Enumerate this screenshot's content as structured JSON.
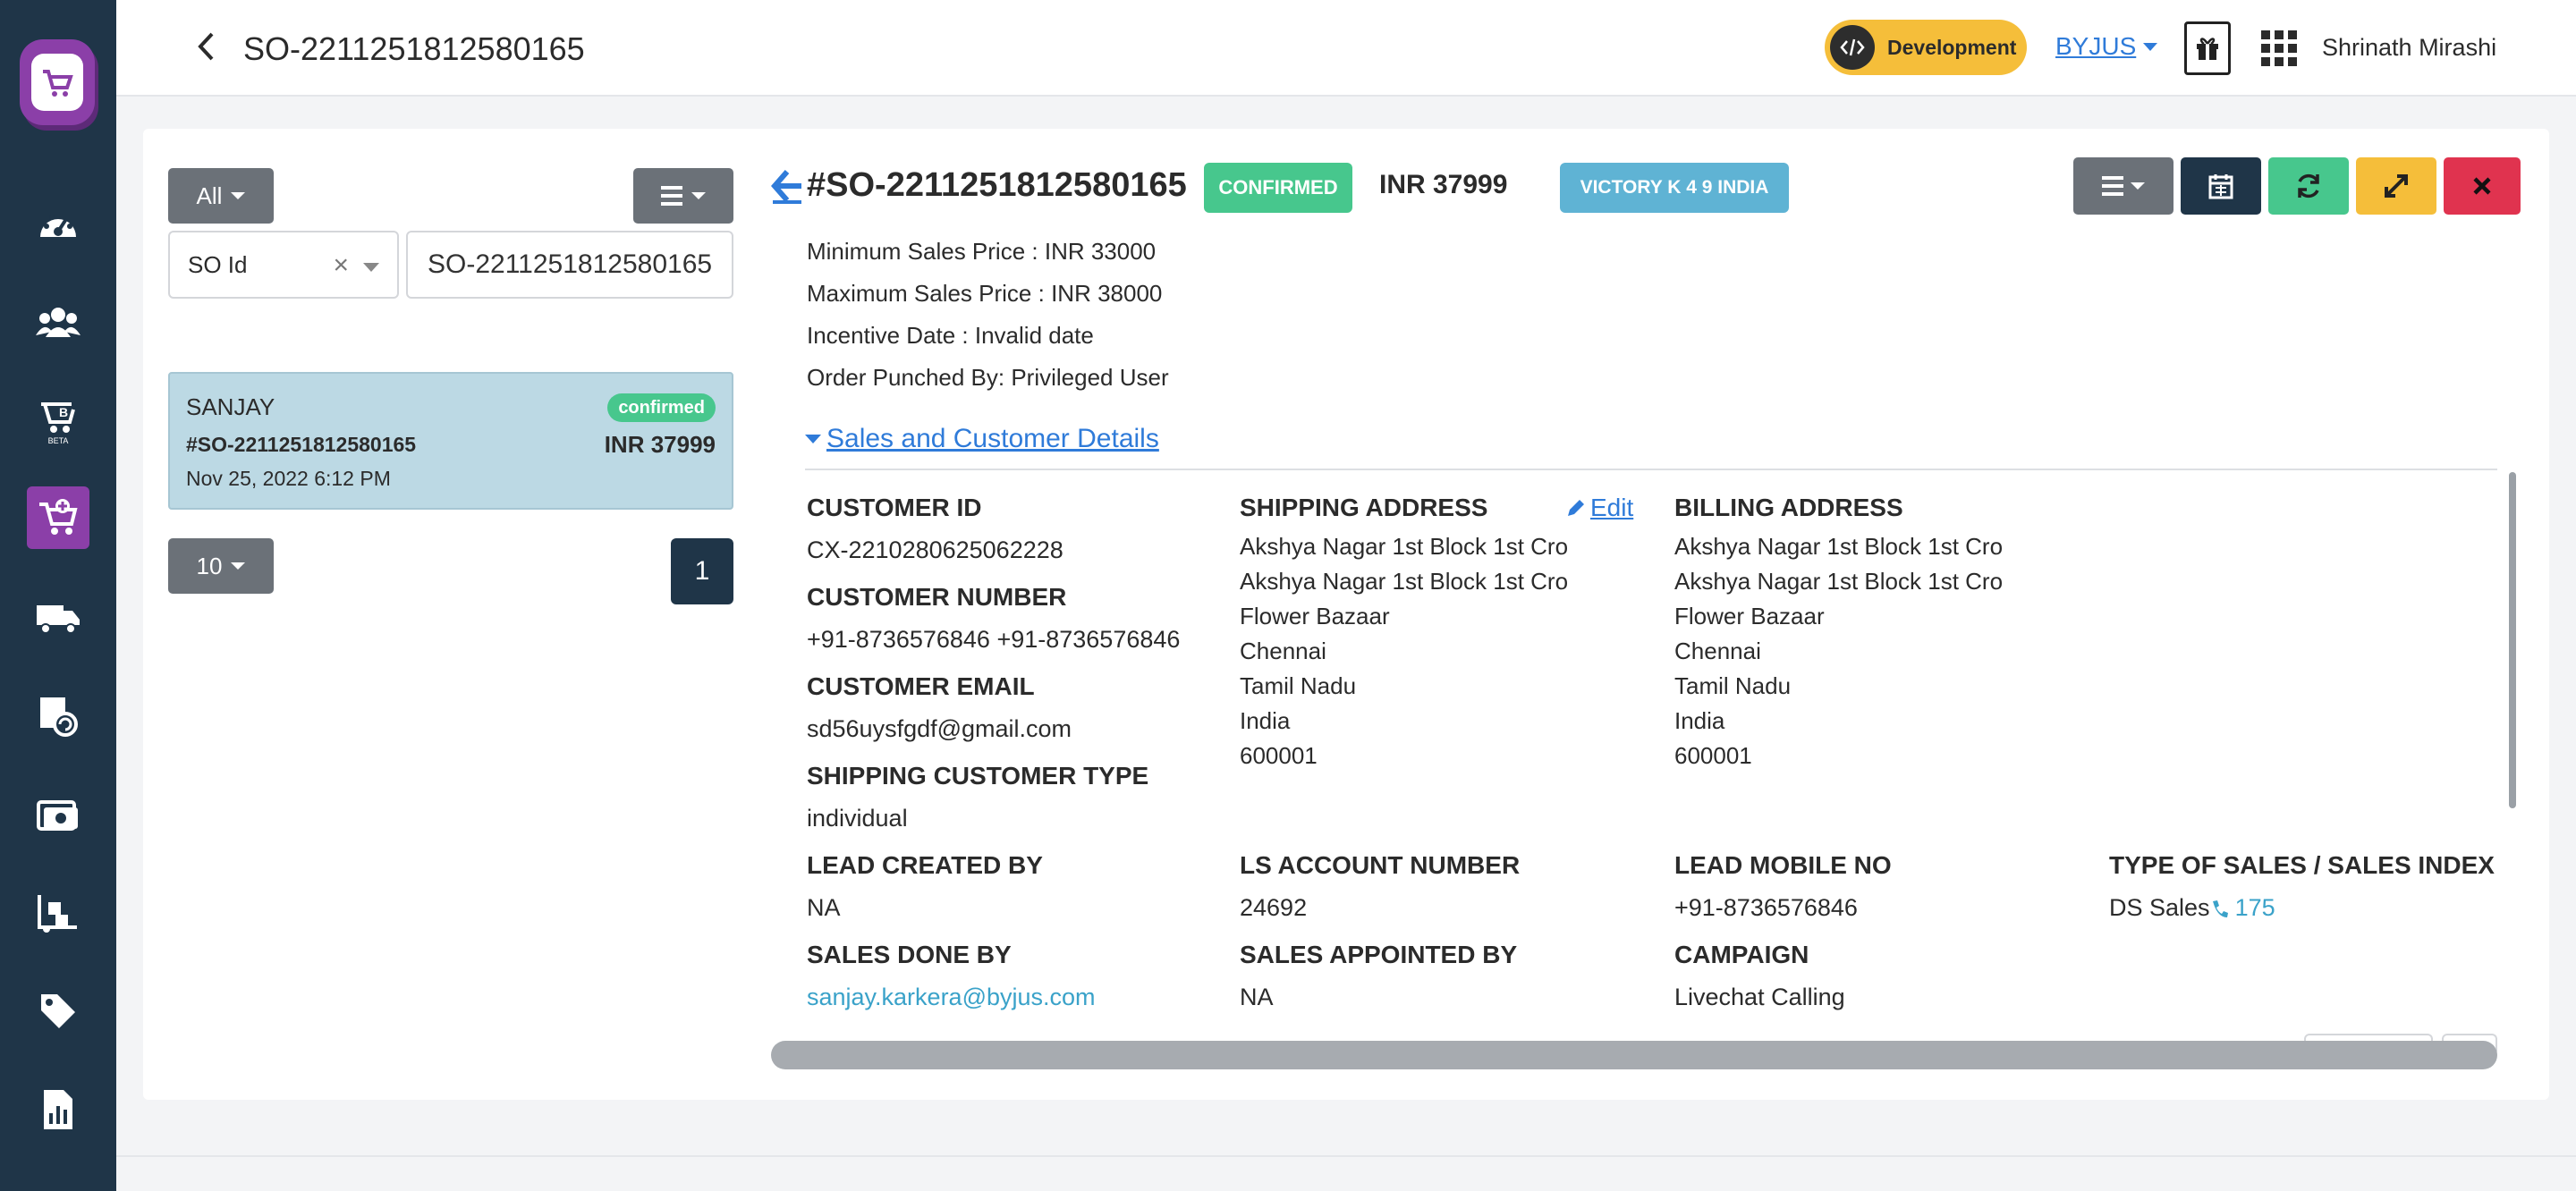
{
  "topbar": {
    "title": "SO-2211251812580165",
    "environment_badge": "Development",
    "org": "BYJUS",
    "user": "Shrinath Mirashi"
  },
  "sidebar": {
    "items": [
      "dashboard-icon",
      "users-icon",
      "learner-beta-icon",
      "cart-add-icon",
      "delivery-truck-icon",
      "package-refresh-icon",
      "cash-icon",
      "warehouse-icon",
      "tag-icon",
      "reports-icon"
    ],
    "active_index": 3,
    "beta_label": "BETA"
  },
  "filters": {
    "status_filter": "All",
    "field_select": "SO Id",
    "search_value": "SO-2211251812580165"
  },
  "list": {
    "items": [
      {
        "name": "SANJAY",
        "status": "confirmed",
        "order_id": "#SO-2211251812580165",
        "amount": "INR 37999",
        "date": "Nov 25, 2022 6:12 PM"
      }
    ],
    "page_size": "10",
    "current_page": "1"
  },
  "detail": {
    "order_id": "#SO-2211251812580165",
    "status": "CONFIRMED",
    "amount": "INR 37999",
    "product": "VICTORY K 4 9 INDIA",
    "min_price": "Minimum Sales Price : INR 33000",
    "max_price": "Maximum Sales Price : INR 38000",
    "incentive_date": "Incentive Date : Invalid date",
    "punched_by": "Order Punched By: Privileged User",
    "section_title": "Sales and Customer Details",
    "edit_label": "Edit",
    "fields": {
      "customer_id_label": "CUSTOMER ID",
      "customer_id": "CX-2210280625062228",
      "customer_number_label": "CUSTOMER NUMBER",
      "customer_number": "+91-8736576846 +91-8736576846",
      "customer_email_label": "CUSTOMER EMAIL",
      "customer_email": "sd56uysfgdf@gmail.com",
      "shipping_customer_type_label": "SHIPPING CUSTOMER TYPE",
      "shipping_customer_type": "individual",
      "shipping_address_label": "SHIPPING ADDRESS",
      "shipping_address": [
        "Akshya Nagar 1st Block 1st Cro",
        "Akshya Nagar 1st Block 1st Cro",
        "Flower Bazaar",
        "Chennai",
        "Tamil Nadu",
        "India",
        "600001"
      ],
      "billing_address_label": "BILLING ADDRESS",
      "billing_address": [
        "Akshya Nagar 1st Block 1st Cro",
        "Akshya Nagar 1st Block 1st Cro",
        "Flower Bazaar",
        "Chennai",
        "Tamil Nadu",
        "India",
        "600001"
      ],
      "lead_created_by_label": "LEAD CREATED BY",
      "lead_created_by": "NA",
      "ls_account_number_label": "LS ACCOUNT NUMBER",
      "ls_account_number": "24692",
      "lead_mobile_label": "LEAD MOBILE NO",
      "lead_mobile": "+91-8736576846",
      "type_of_sales_label": "TYPE OF SALES / SALES INDEX",
      "type_of_sales": "DS Sales",
      "sales_index": "175",
      "sales_done_by_label": "SALES DONE BY",
      "sales_done_by": "sanjay.karkera@byjus.com",
      "sales_appointed_by_label": "SALES APPOINTED BY",
      "sales_appointed_by": "NA",
      "campaign_label": "CAMPAIGN",
      "campaign": "Livechat Calling"
    }
  },
  "colors": {
    "sidebar": "#1f3548",
    "accent_purple": "#8b3fa8",
    "success": "#47c78d",
    "info": "#5fb3d4",
    "warning": "#f5be3a",
    "danger": "#e0334f",
    "link": "#2f7bd9"
  }
}
